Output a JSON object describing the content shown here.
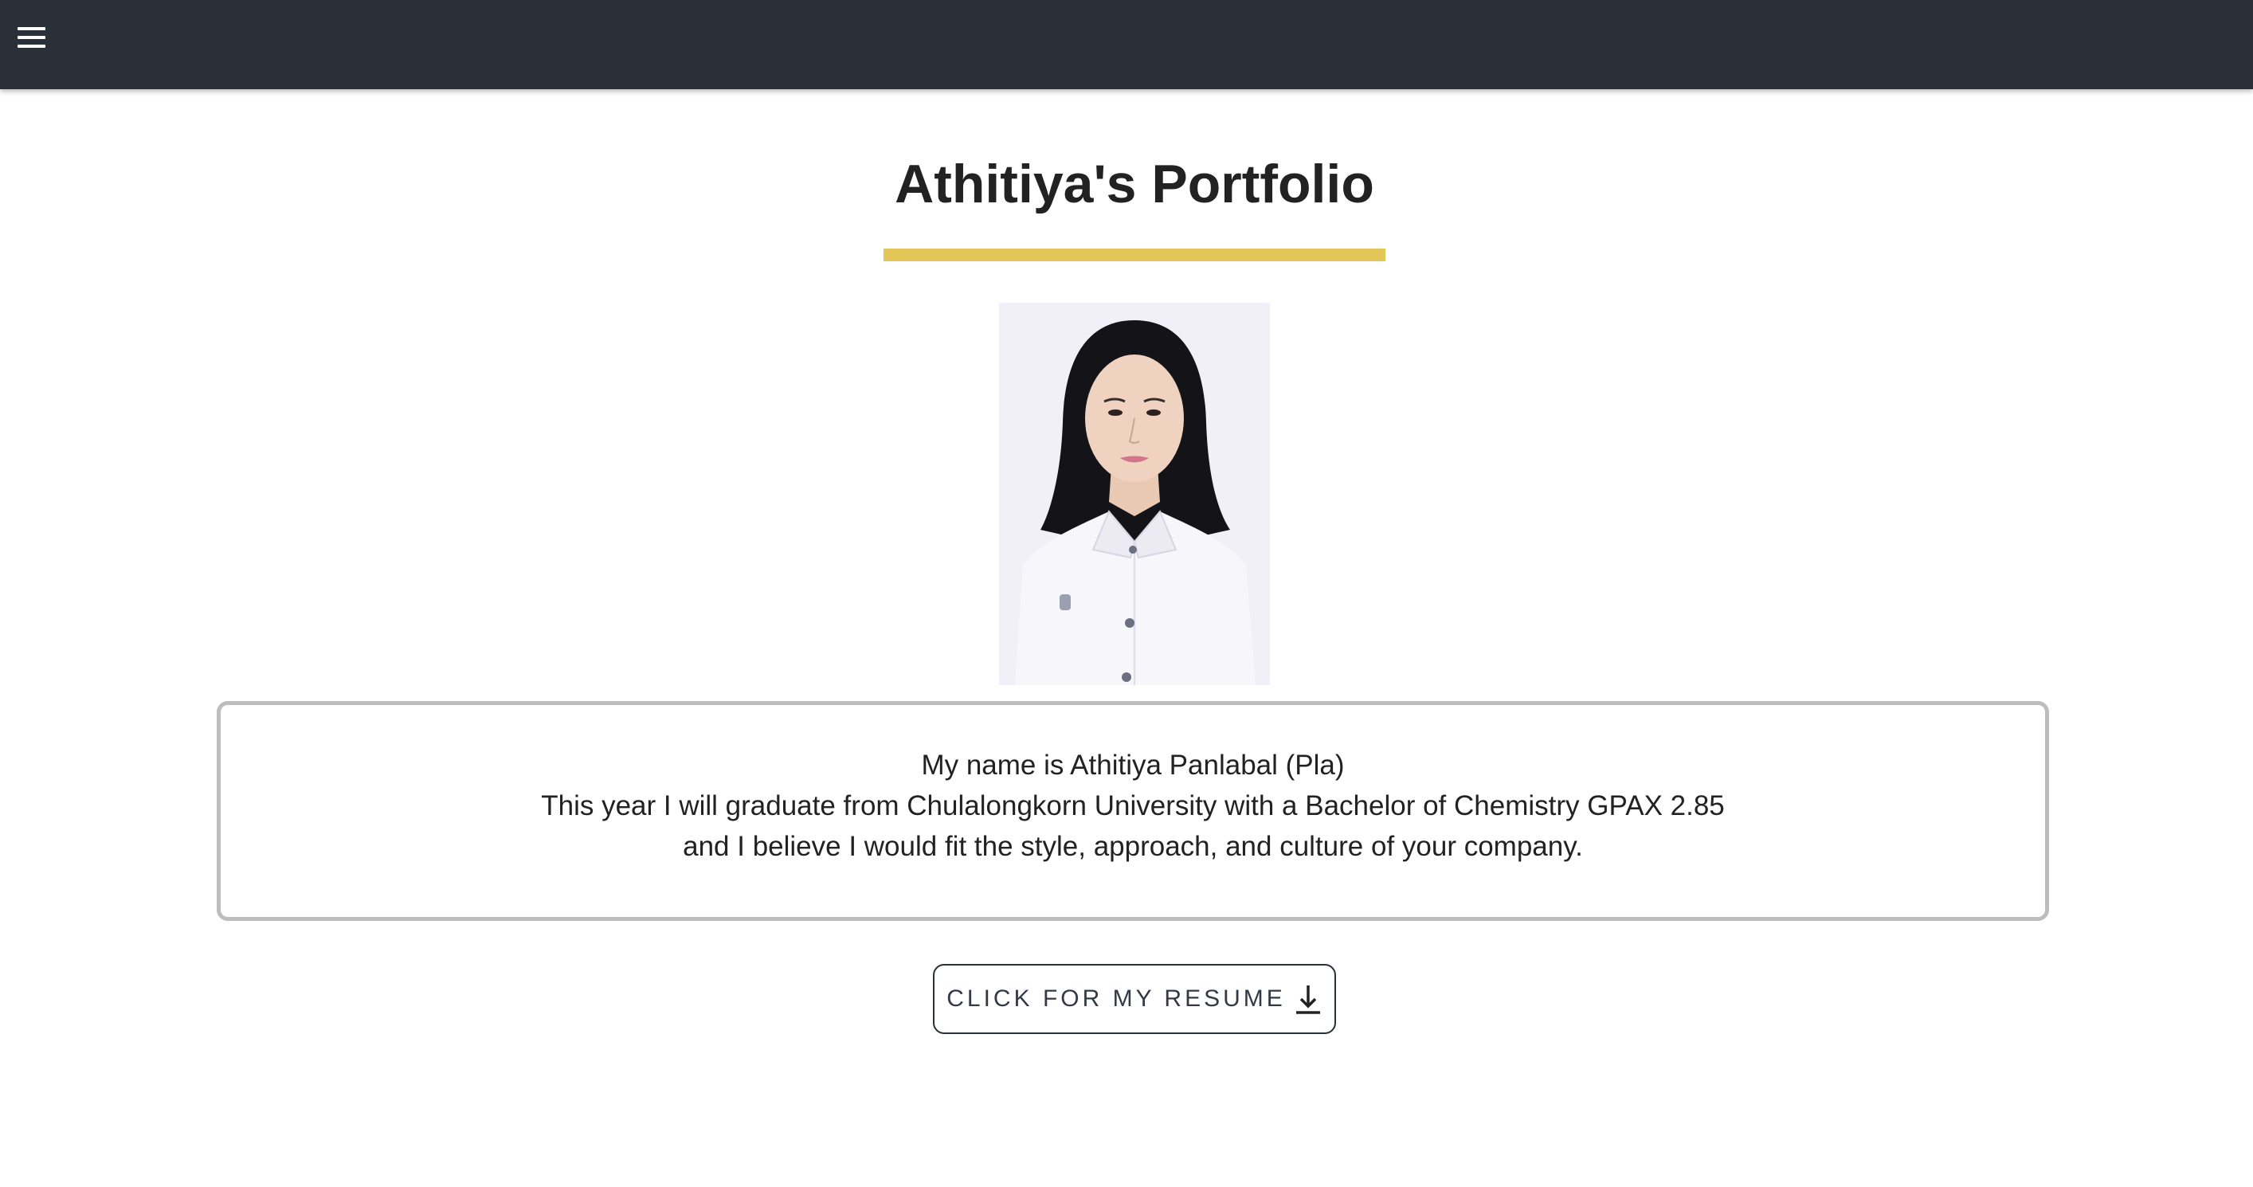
{
  "header": {
    "menu_icon": "hamburger-menu-icon",
    "background_color": "#2a3037"
  },
  "page": {
    "title": "Athitiya's Portfolio",
    "accent_color": "#e2c657"
  },
  "about": {
    "lines": [
      "My name is Athitiya Panlabal (Pla)",
      "This year I will graduate from Chulalongkorn University with a Bachelor of Chemistry GPAX 2.85",
      "and I believe I would fit the style, approach, and culture of your company."
    ]
  },
  "resume_button": {
    "label": "CLICK FOR MY RESUME",
    "icon": "download-icon"
  }
}
